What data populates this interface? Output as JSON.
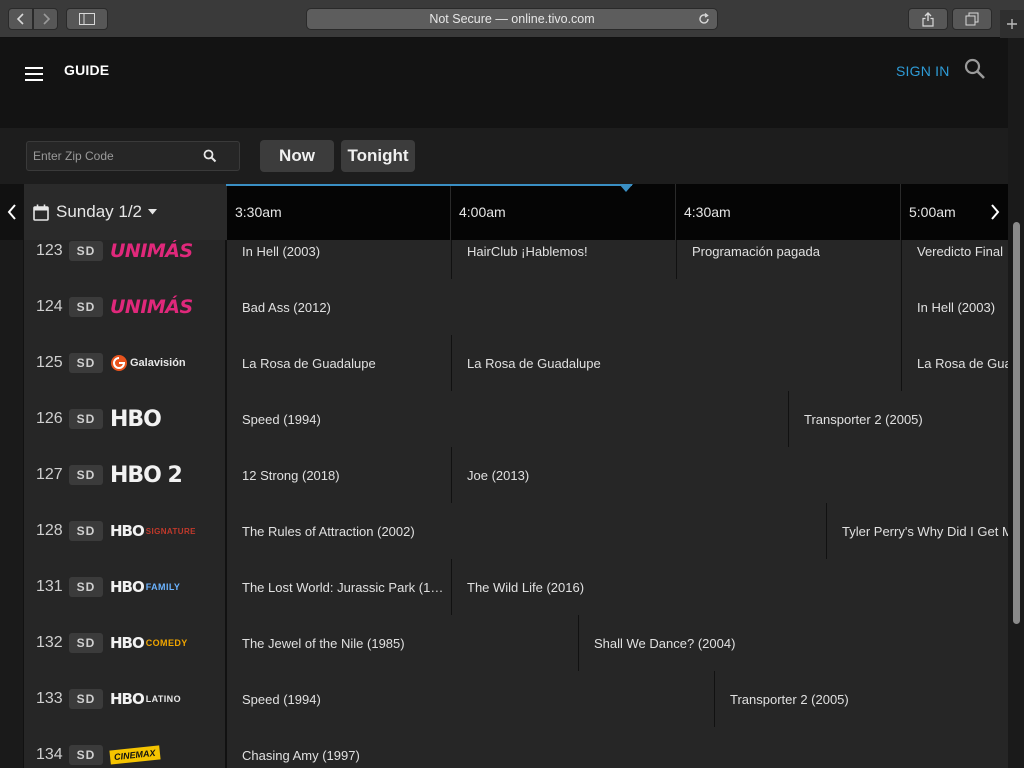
{
  "browser": {
    "url_text": "Not Secure — online.tivo.com"
  },
  "header": {
    "title": "GUIDE",
    "sign_in": "SIGN IN"
  },
  "filters": {
    "zip_placeholder": "Enter Zip Code",
    "now_label": "Now",
    "tonight_label": "Tonight"
  },
  "timebar": {
    "date": "Sunday 1/2",
    "slots": [
      "3:30am",
      "4:00am",
      "4:30am",
      "5:00am"
    ]
  },
  "channels": [
    {
      "number": "123",
      "quality": "SD",
      "logo": "UNIMÁS",
      "programs": [
        "In Hell (2003)",
        "HairClub ¡Hablemos!",
        "Programación pagada",
        "Veredicto Final"
      ]
    },
    {
      "number": "124",
      "quality": "SD",
      "logo": "UNIMÁS",
      "programs": [
        "Bad Ass (2012)",
        "In Hell (2003)"
      ]
    },
    {
      "number": "125",
      "quality": "SD",
      "logo": "Galavisión",
      "programs": [
        "La Rosa de Guadalupe",
        "La Rosa de Guadalupe",
        "La Rosa de Guadalupe"
      ]
    },
    {
      "number": "126",
      "quality": "SD",
      "logo": "HBO",
      "programs": [
        "Speed (1994)",
        "Transporter 2 (2005)"
      ]
    },
    {
      "number": "127",
      "quality": "SD",
      "logo": "HBO 2",
      "programs": [
        "12 Strong (2018)",
        "Joe (2013)"
      ]
    },
    {
      "number": "128",
      "quality": "SD",
      "logo_mark": "HBO",
      "logo_sub": "SIGNATURE",
      "programs": [
        "The Rules of Attraction (2002)",
        "Tyler Perry's Why Did I Get Married?"
      ]
    },
    {
      "number": "131",
      "quality": "SD",
      "logo_mark": "HBO",
      "logo_sub": "FAMILY",
      "programs": [
        "The Lost World: Jurassic Park (1…",
        "The Wild Life (2016)"
      ]
    },
    {
      "number": "132",
      "quality": "SD",
      "logo_mark": "HBO",
      "logo_sub": "COMEDY",
      "programs": [
        "The Jewel of the Nile (1985)",
        "Shall We Dance? (2004)"
      ]
    },
    {
      "number": "133",
      "quality": "SD",
      "logo_mark": "HBO",
      "logo_sub": "LATINO",
      "programs": [
        "Speed (1994)",
        "Transporter 2 (2005)"
      ]
    },
    {
      "number": "134",
      "quality": "SD",
      "logo": "CINEMAX",
      "programs": [
        "Chasing Amy (1997)"
      ]
    }
  ],
  "colors": {
    "accent": "#2e9bd6",
    "unimas": "#e0287b",
    "cinemax": "#f5c400"
  }
}
